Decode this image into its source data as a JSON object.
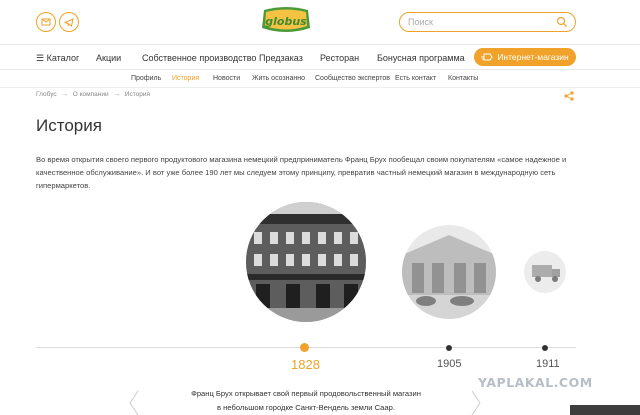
{
  "brand": {
    "logo_text": "globus",
    "accent": "#f0a22a",
    "green": "#4a9a3a"
  },
  "header": {
    "icons": [
      "mail-icon",
      "telegram-icon"
    ],
    "search_placeholder": "Поиск"
  },
  "nav": {
    "catalog_label": "Каталог",
    "items": [
      "Акции",
      "Собственное производство",
      "Предзаказ",
      "Ресторан",
      "Бонусная программа"
    ],
    "cta_label": "Интернет-магазин"
  },
  "subnav": {
    "items": [
      "Профиль",
      "История",
      "Новости",
      "Жить осознанно",
      "Сообщество экспертов",
      "Есть контакт",
      "Контакты"
    ],
    "active": "История"
  },
  "breadcrumb": [
    "Глобус",
    "О компании",
    "История"
  ],
  "page": {
    "title": "История",
    "intro": "Во время открытия своего первого продуктового магазина немецкий предприниматель Франц Брух пообещал своим покупателям «самое надежное и качественное обслуживание». И вот уже более 190 лет мы следуем этому принципу, превратив частный немецкий магазин в международную сеть гипермаркетов."
  },
  "timeline": {
    "years": [
      {
        "label": "1828",
        "active": true
      },
      {
        "label": "1905",
        "active": false
      },
      {
        "label": "1911",
        "active": false
      }
    ],
    "caption_line1": "Франц Брух открывает свой первый продовольственный магазин",
    "caption_line2": "в небольшом городке Санкт-Вендель земли Саар."
  },
  "watermark": "YAPLAKAL.COM"
}
